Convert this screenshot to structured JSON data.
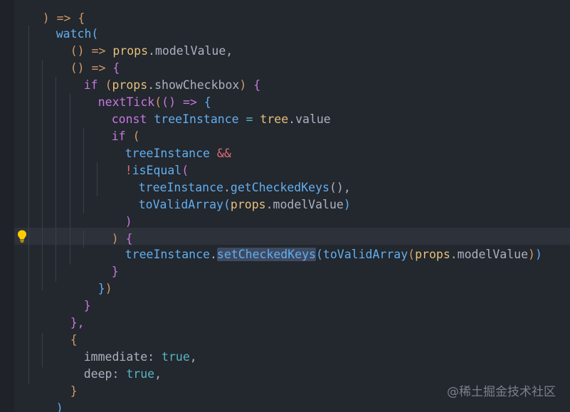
{
  "editor": {
    "lines": [
      {
        "t1": ") => {"
      },
      {
        "t1": "watch("
      },
      {
        "t1": "() => ",
        "t2": "props",
        "t3": ".modelValue,"
      },
      {
        "t1": "() => ",
        "t2": "{"
      },
      {
        "t1": "if ",
        "t2": "(",
        "t3": "props",
        "t4": ".showCheckbox",
        "t5": ") ",
        "t6": "{"
      },
      {
        "t1": "nextTick",
        "t2": "(",
        "t3": "() => ",
        "t4": "{"
      },
      {
        "t1": "const ",
        "t2": "treeInstance",
        "t3": " = ",
        "t4": "tree",
        "t5": ".value"
      },
      {
        "t1": "if ",
        "t2": "("
      },
      {
        "t1": "treeInstance",
        "t2": " &&"
      },
      {
        "t1": "!",
        "t2": "isEqual",
        "t3": "("
      },
      {
        "t1": "treeInstance",
        "t2": ".",
        "t3": "getCheckedKeys",
        "t4": "(),"
      },
      {
        "t1": "toValidArray",
        "t2": "(",
        "t3": "props",
        "t4": ".modelValue",
        "t5": ")"
      },
      {
        "t1": ")"
      },
      {
        "t1": ") ",
        "t2": "{"
      },
      {
        "t1": "treeInstance",
        "t2": ".",
        "t3": "setCheckedKeys",
        "t4": "(",
        "t5": "toValidArray",
        "t6": "(",
        "t7": "props",
        "t8": ".modelValue",
        "t9": ")",
        "t10": ")"
      },
      {
        "t1": "}"
      },
      {
        "t1": "}",
        "t2": ")"
      },
      {
        "t1": "}"
      },
      {
        "t1": "},"
      },
      {
        "t1": "{"
      },
      {
        "t1": "immediate: ",
        "t2": "true",
        "t3": ","
      },
      {
        "t1": "deep: ",
        "t2": "true",
        "t3": ","
      },
      {
        "t1": "}"
      },
      {
        "t1": ")"
      }
    ]
  },
  "lightbulb_icon": "lightbulb-icon",
  "watermark": "@稀土掘金技术社区"
}
